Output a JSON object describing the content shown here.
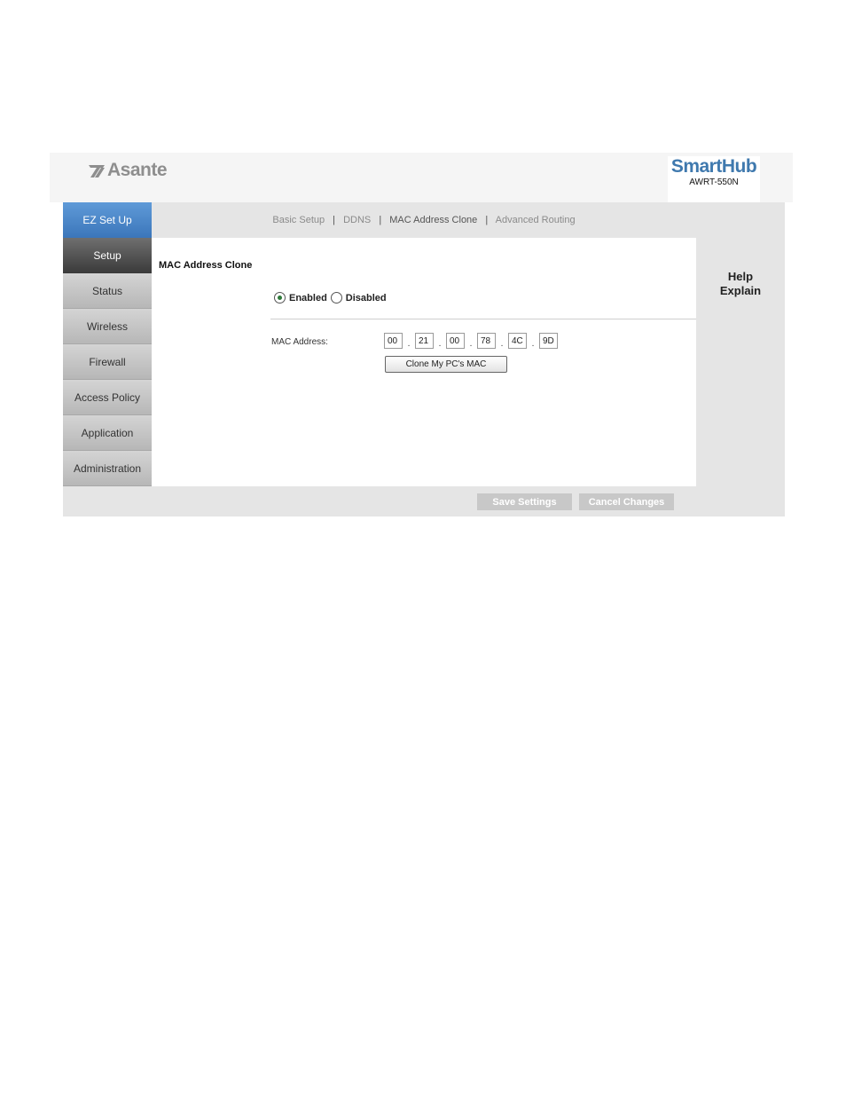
{
  "header": {
    "brand": "Asante",
    "product": "SmartHub",
    "model": "AWRT-550N"
  },
  "sidebar": {
    "items": [
      {
        "label": "EZ Set Up"
      },
      {
        "label": "Setup"
      },
      {
        "label": "Status"
      },
      {
        "label": "Wireless"
      },
      {
        "label": "Firewall"
      },
      {
        "label": "Access Policy"
      },
      {
        "label": "Application"
      },
      {
        "label": "Administration"
      }
    ],
    "active": "Setup"
  },
  "subnav": {
    "tabs": [
      {
        "label": "Basic Setup"
      },
      {
        "label": "DDNS"
      },
      {
        "label": "MAC Address Clone"
      },
      {
        "label": "Advanced Routing"
      }
    ],
    "separator": "|",
    "current": "MAC Address Clone"
  },
  "main": {
    "section_title": "MAC Address Clone",
    "mode": {
      "enabled_label": "Enabled",
      "disabled_label": "Disabled",
      "selected": "Enabled"
    },
    "mac": {
      "label": "MAC Address:",
      "octets": [
        "00",
        "21",
        "00",
        "78",
        "4C",
        "9D"
      ],
      "separator": "."
    },
    "clone_button": "Clone My PC's MAC"
  },
  "help": {
    "title_line1": "Help",
    "title_line2": "Explain"
  },
  "actions": {
    "save": "Save Settings",
    "cancel": "Cancel Changes"
  },
  "colors": {
    "accent_blue": "#3f79ae",
    "ez_button": "#4a86c8",
    "active_nav": "#505050",
    "frame_gray": "#e5e5e5",
    "radio_selected": "#2f7a3a"
  }
}
